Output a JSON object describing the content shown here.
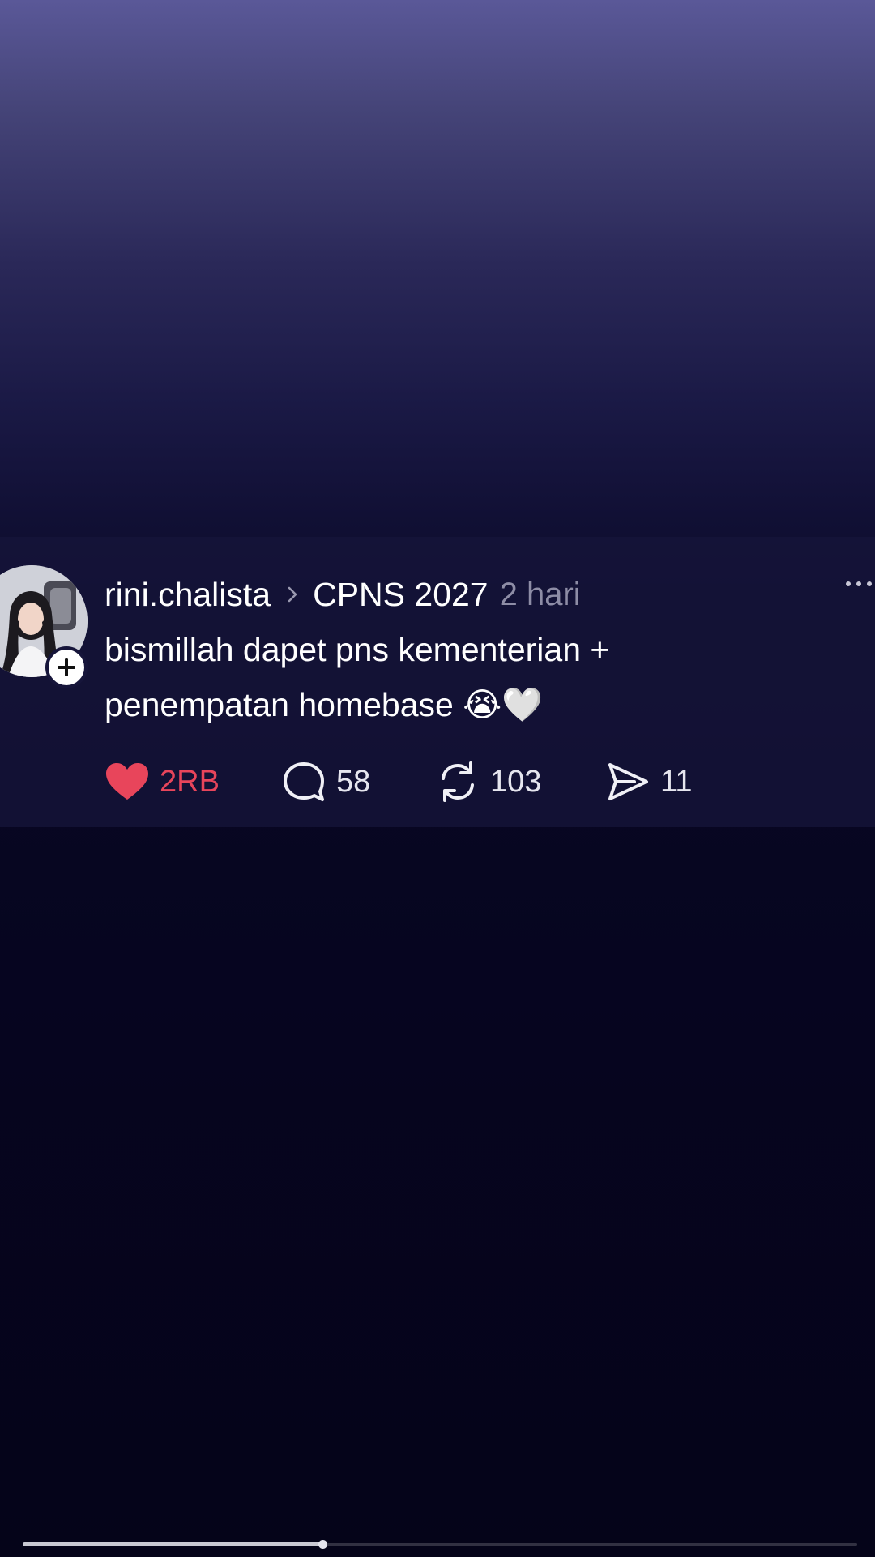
{
  "post": {
    "username": "rini.chalista",
    "community": "CPNS 2027",
    "time": "2 hari",
    "text_line1": "bismillah dapet pns kementerian +",
    "text_line2": "penempatan homebase 😭🤍",
    "likes": "2RB",
    "comments": "58",
    "reposts": "103",
    "shares": "11"
  },
  "icons": {
    "avatar": "avatar",
    "follow": "plus-icon",
    "chevron": "chevron-right-icon",
    "more": "more-icon",
    "like": "heart-icon",
    "comment": "comment-icon",
    "repost": "repost-icon",
    "share": "send-icon"
  },
  "colors": {
    "like": "#e8455b",
    "text": "#ffffff",
    "muted": "#8e8da6"
  },
  "progress": {
    "played_fraction": 0.36
  }
}
